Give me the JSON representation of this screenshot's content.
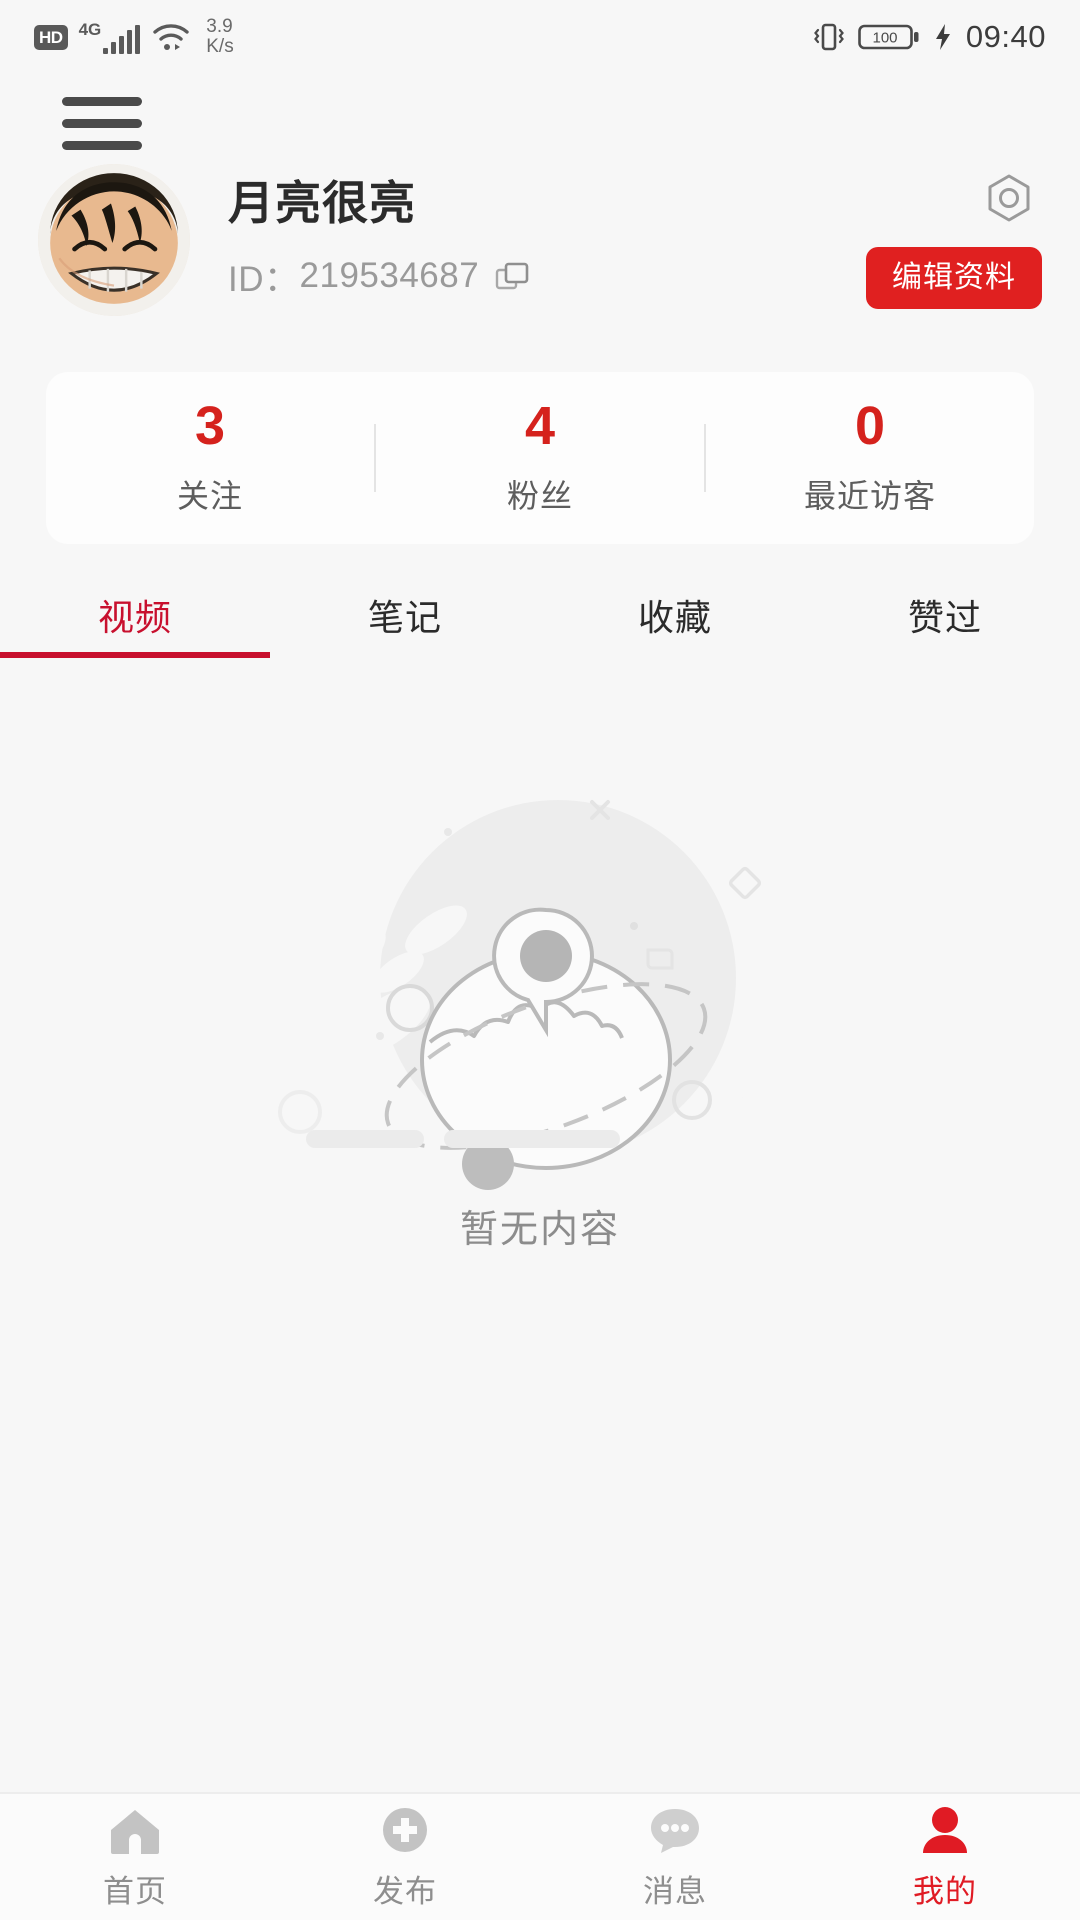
{
  "status_bar": {
    "hd_label": "HD",
    "network_type": "4G",
    "speed_value": "3.9",
    "speed_unit": "K/s",
    "battery_level": "100",
    "time": "09:40",
    "icons": {
      "hd": "hd-icon",
      "signal": "signal-bars-icon",
      "wifi": "wifi-icon",
      "vibrate": "vibrate-icon",
      "battery": "battery-icon",
      "charging": "charging-bolt-icon"
    }
  },
  "header": {
    "menu_icon": "hamburger-menu-icon"
  },
  "profile": {
    "username": "月亮很亮",
    "id_label": "ID：",
    "id_value": "219534687",
    "copy_icon": "copy-icon",
    "settings_icon": "settings-hexagon-icon",
    "edit_button_label": "编辑资料",
    "accent_color": "#e02020"
  },
  "stats": [
    {
      "value": "3",
      "label": "关注"
    },
    {
      "value": "4",
      "label": "粉丝"
    },
    {
      "value": "0",
      "label": "最近访客"
    }
  ],
  "tabs": [
    {
      "label": "视频",
      "active": true
    },
    {
      "label": "笔记",
      "active": false
    },
    {
      "label": "收藏",
      "active": false
    },
    {
      "label": "赞过",
      "active": false
    }
  ],
  "empty_state": {
    "illustration": "planet-empty-illustration",
    "message": "暂无内容"
  },
  "bottom_nav": [
    {
      "label": "首页",
      "icon": "home-icon",
      "active": false
    },
    {
      "label": "发布",
      "icon": "plus-circle-icon",
      "active": false
    },
    {
      "label": "消息",
      "icon": "chat-bubble-icon",
      "active": false
    },
    {
      "label": "我的",
      "icon": "person-icon",
      "active": true
    }
  ],
  "colors": {
    "accent_red": "#e02020",
    "stat_red": "#d5221d",
    "tab_active": "#c8102e",
    "page_bg": "#f7f7f7",
    "muted_text": "#8e8e8e"
  }
}
